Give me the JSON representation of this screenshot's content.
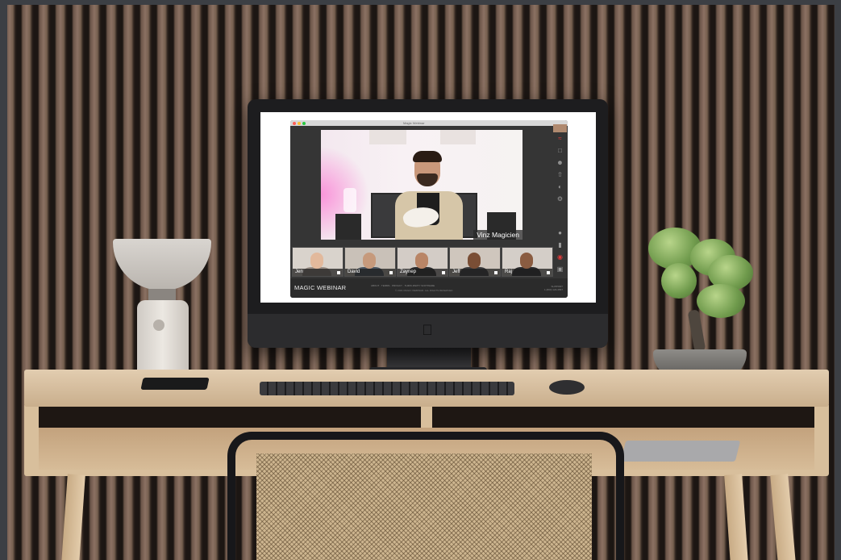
{
  "window": {
    "title": "Magic Webinar"
  },
  "stage": {
    "presenter_name": "Vinz Magicien"
  },
  "participants": [
    {
      "name": "Jen"
    },
    {
      "name": "David"
    },
    {
      "name": "Zaynep"
    },
    {
      "name": "Jeff"
    },
    {
      "name": "Raj"
    }
  ],
  "footer": {
    "brand": "MAGIC WEBINAR",
    "links": "ABOUT  ·  TERMS  ·  PRIVACY  ·  THIRD-PARTY SOFTWARE",
    "sub": "© 2021 MAGIC WEBINAR. ALL RIGHTS RESERVED",
    "contact_label": "SUPPORT",
    "contact_value": "1 (800) 123-4567"
  },
  "colors": {
    "accent_red": "#e03a3a",
    "app_bg": "#353535"
  },
  "sidebar_icons": [
    "broadcast-icon",
    "chat-icon",
    "people-icon",
    "share-icon",
    "globe-icon",
    "gear-icon",
    "mic-icon",
    "video-icon",
    "record-icon",
    "fullscreen-icon"
  ]
}
